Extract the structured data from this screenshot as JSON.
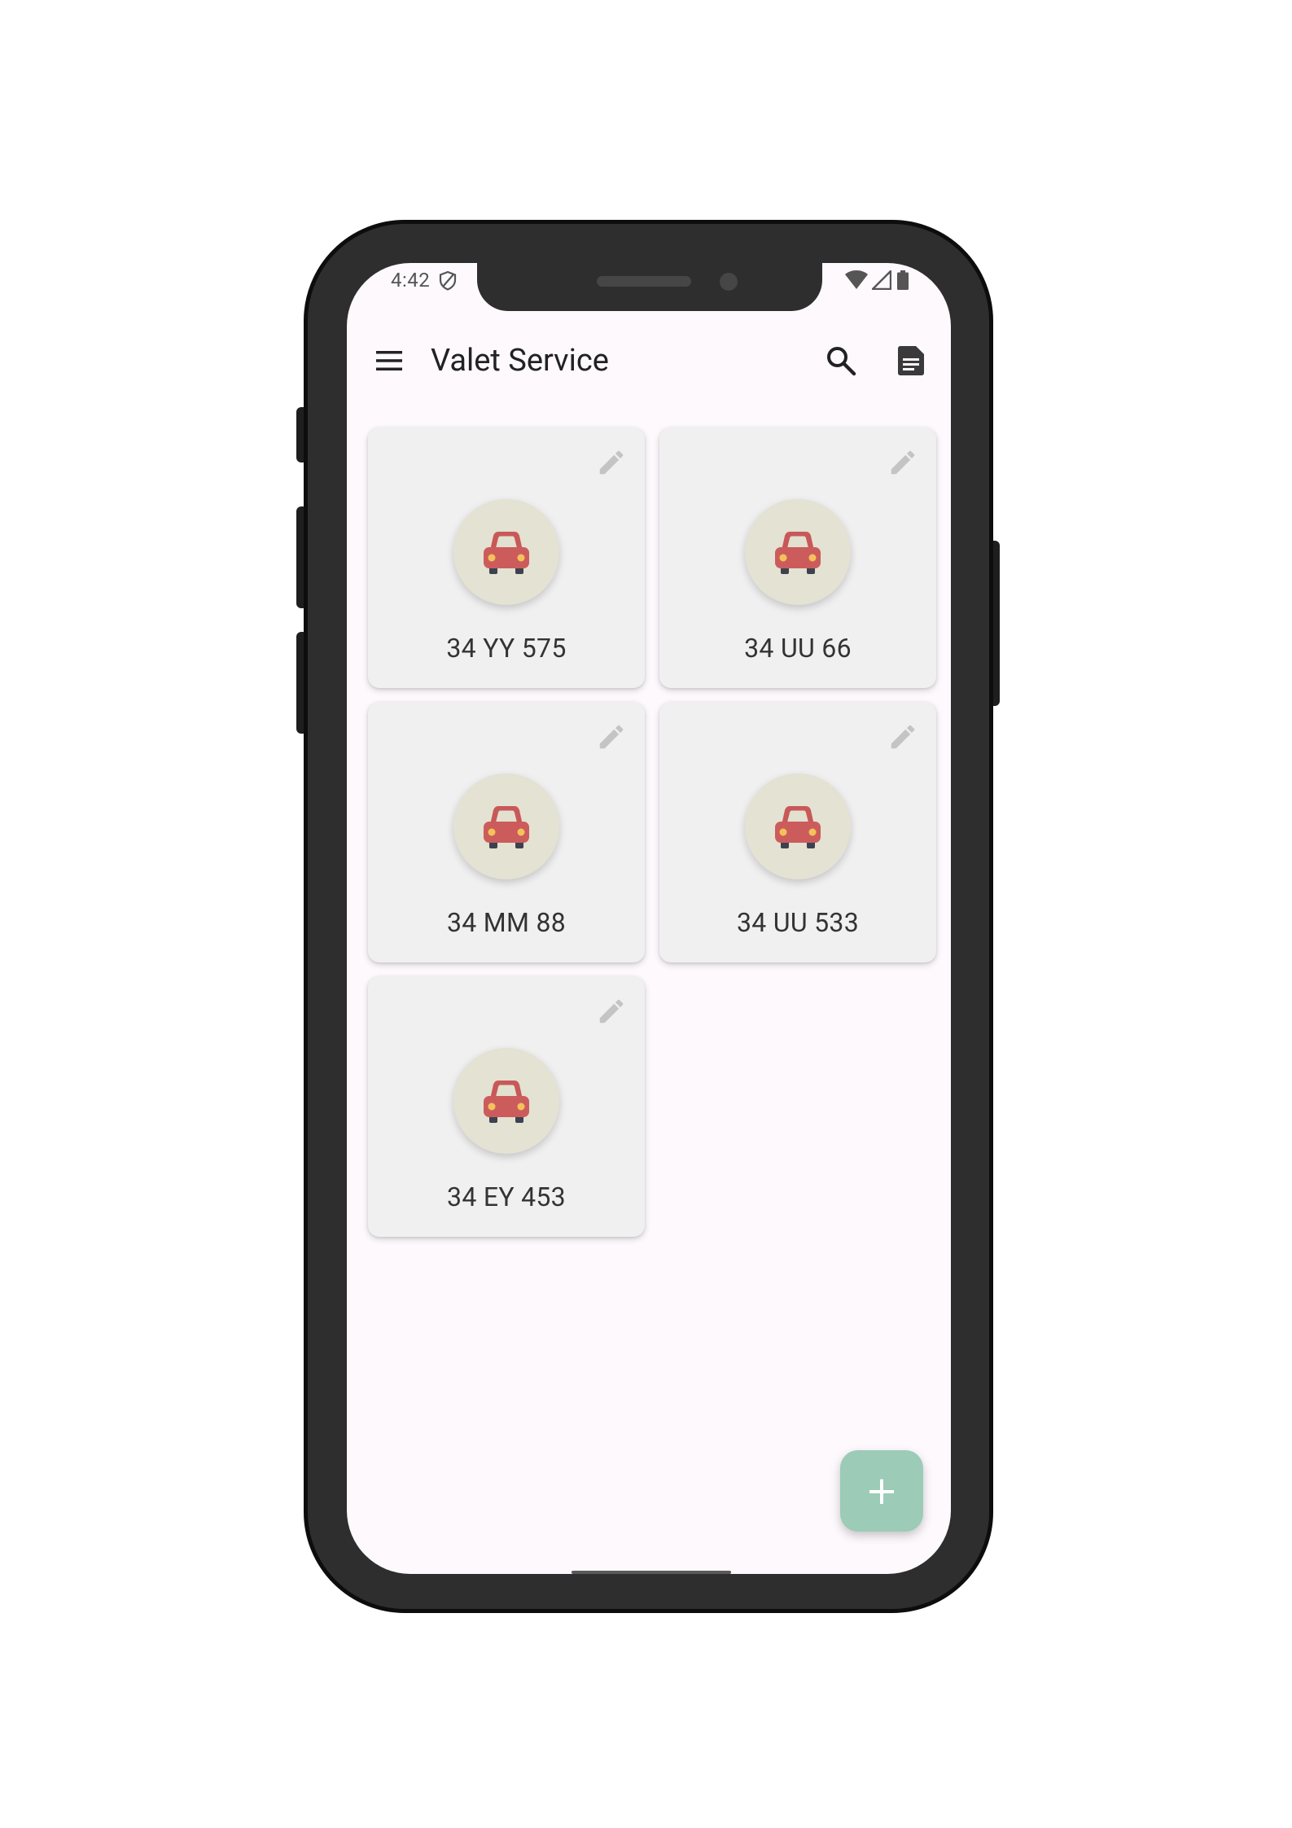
{
  "status_bar": {
    "time": "4:42",
    "icons": [
      "shield-icon",
      "wifi-icon",
      "signal-icon",
      "battery-icon"
    ]
  },
  "app_bar": {
    "title": "Valet Service",
    "icons": {
      "menu": "hamburger-menu-icon",
      "search": "search-icon",
      "report": "document-icon"
    }
  },
  "vehicles": [
    {
      "plate": "34 YY 575",
      "icon": "car-icon"
    },
    {
      "plate": "34 UU 66",
      "icon": "car-icon"
    },
    {
      "plate": "34 MM 88",
      "icon": "car-icon"
    },
    {
      "plate": "34 UU 533",
      "icon": "car-icon"
    },
    {
      "plate": "34 EY 453",
      "icon": "car-icon"
    }
  ],
  "fab": {
    "label": "+"
  },
  "colors": {
    "screen_background": "#fdf9fd",
    "card_background": "#f1f0f1",
    "car_circle": "#e3e2d3",
    "car_body": "#cc5c5c",
    "fab_background": "#9ccbb8",
    "phone_frame": "#2e2e2e"
  }
}
